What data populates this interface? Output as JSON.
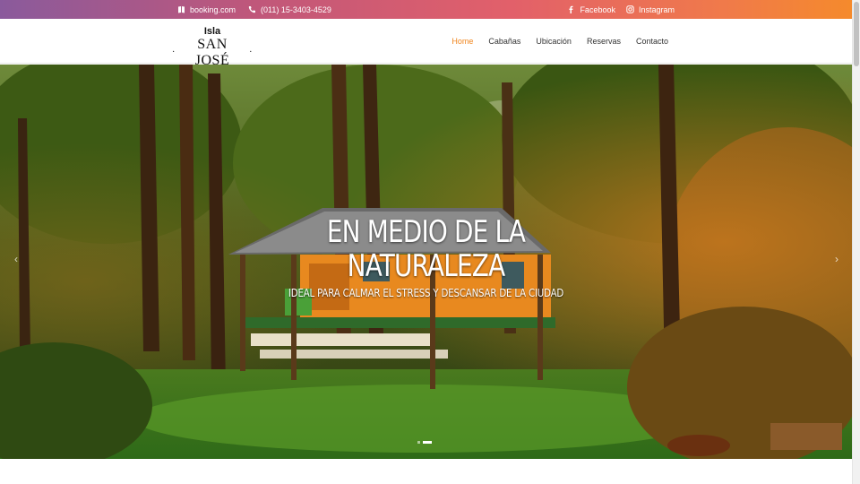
{
  "topbar": {
    "booking": "booking.com",
    "phone": "(011) 15-3403-4529",
    "facebook": "Facebook",
    "instagram": "Instagram"
  },
  "logo": {
    "top": "Isla",
    "main": "SAN JOSÉ"
  },
  "nav": {
    "items": [
      "Home",
      "Cabañas",
      "Ubicación",
      "Reservas",
      "Contacto"
    ],
    "active": "Home"
  },
  "hero": {
    "title_line1": "EN MEDIO DE LA",
    "title_line2": "NATURALEZA",
    "subtitle": "IDEAL PARA CALMAR EL STRESS Y DESCANSAR DE LA CIUDAD"
  },
  "slider": {
    "slide_count": 2,
    "active_index": 1
  },
  "icons": {
    "booking": "book-icon",
    "phone": "phone-icon",
    "facebook": "facebook-icon",
    "instagram": "instagram-icon",
    "prev": "chevron-left-icon",
    "next": "chevron-right-icon"
  },
  "colors": {
    "accent": "#f0861f",
    "topbar_start": "#8a5a9c",
    "topbar_end": "#f58a2c"
  }
}
